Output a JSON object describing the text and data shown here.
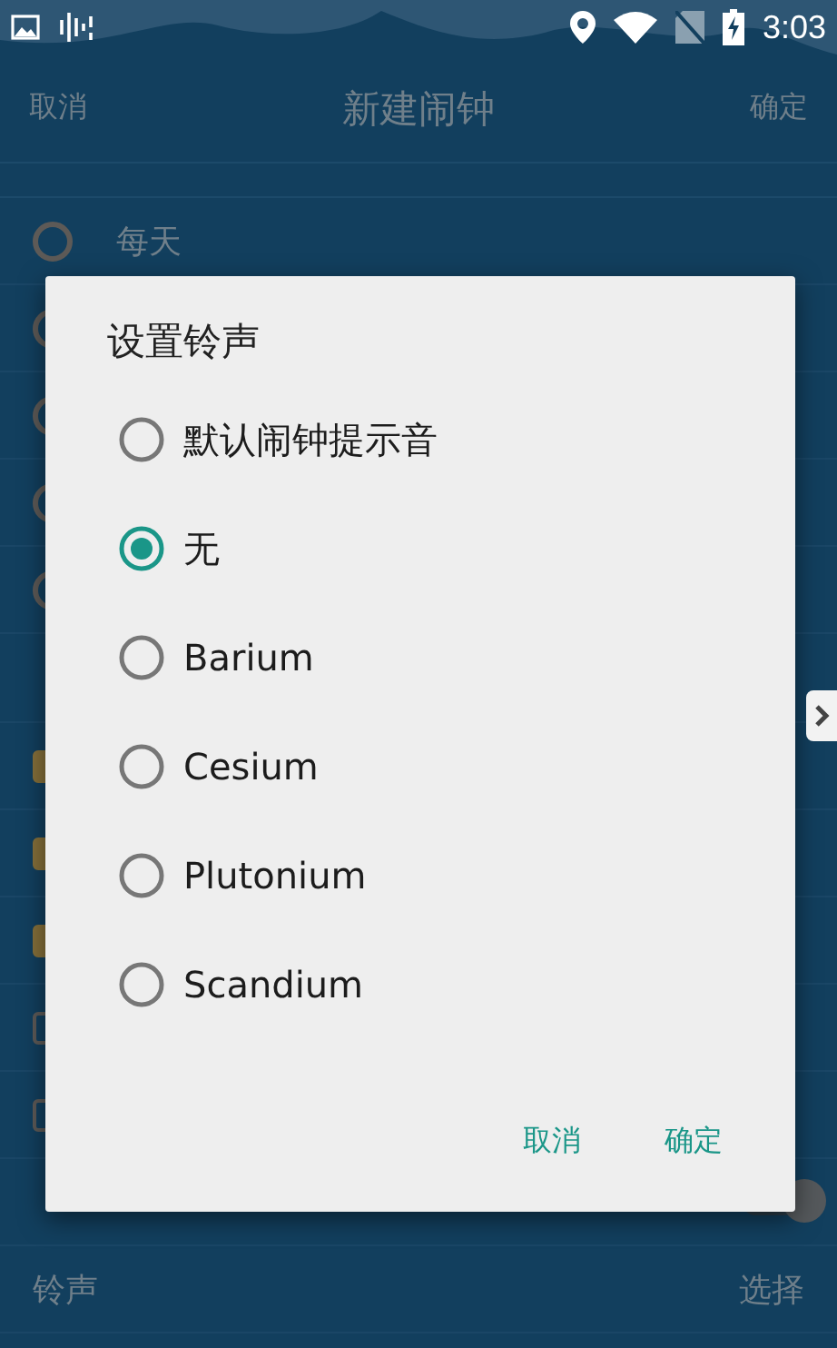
{
  "status_bar": {
    "time": "3:03"
  },
  "header": {
    "cancel": "取消",
    "title": "新建闹钟",
    "confirm": "确定"
  },
  "background_rows": [
    {
      "kind": "radio",
      "label": "每天",
      "selected": false
    },
    {
      "kind": "radio",
      "selected": false
    },
    {
      "kind": "radio",
      "selected": false
    },
    {
      "kind": "radio",
      "selected": false
    },
    {
      "kind": "radio",
      "selected": false
    },
    {
      "kind": "section"
    },
    {
      "kind": "checkbox",
      "checked": true
    },
    {
      "kind": "checkbox",
      "checked": true
    },
    {
      "kind": "checkbox",
      "checked": true
    },
    {
      "kind": "checkbox",
      "checked": false
    },
    {
      "kind": "checkbox",
      "checked": false
    },
    {
      "kind": "toggle",
      "on": false
    },
    {
      "kind": "value",
      "label": "铃声",
      "value": "选择"
    }
  ],
  "dialog": {
    "title": "设置铃声",
    "options": [
      {
        "label": "默认闹钟提示音",
        "selected": false
      },
      {
        "label": "无",
        "selected": true
      },
      {
        "label": "Barium",
        "selected": false
      },
      {
        "label": "Cesium",
        "selected": false
      },
      {
        "label": "Plutonium",
        "selected": false
      },
      {
        "label": "Scandium",
        "selected": false
      }
    ],
    "buttons": [
      "取消",
      "确定"
    ]
  }
}
